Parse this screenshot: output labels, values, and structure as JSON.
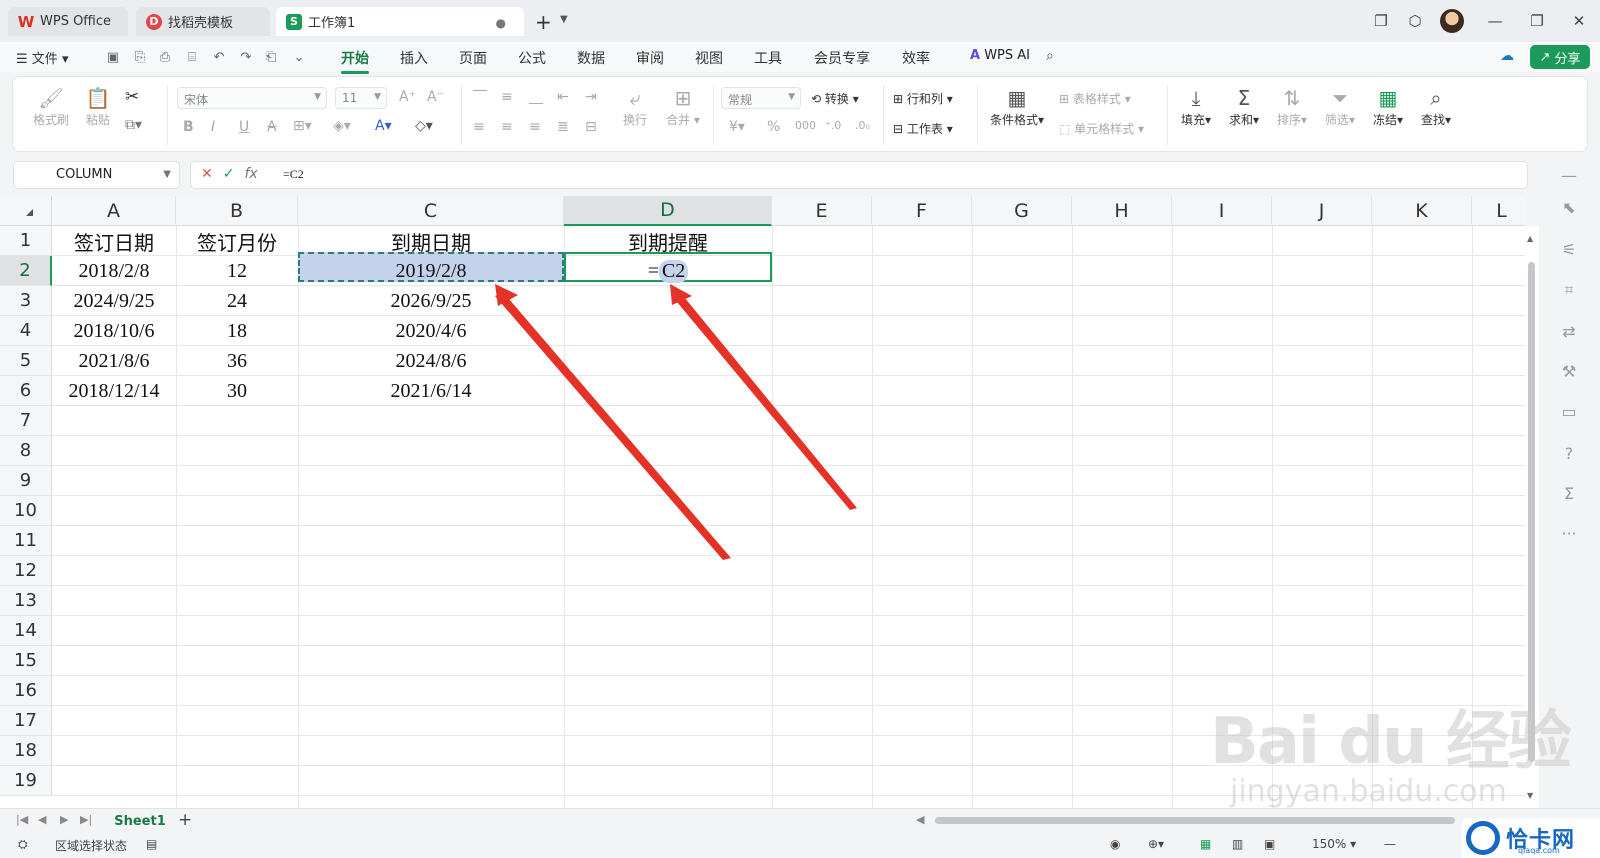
{
  "tabs": [
    {
      "label": "WPS Office"
    },
    {
      "label": "找稻壳模板"
    },
    {
      "label": "工作簿1"
    }
  ],
  "menu": {
    "file": "文件",
    "tabs": [
      "开始",
      "插入",
      "页面",
      "公式",
      "数据",
      "审阅",
      "视图",
      "工具",
      "会员专享",
      "效率"
    ],
    "active_tab": "开始",
    "wps_ai": "WPS AI",
    "share": "分享"
  },
  "ribbon": {
    "format_painter": "格式刷",
    "paste": "粘贴",
    "font_name": "宋体",
    "font_size": "11",
    "wrap": "换行",
    "merge": "合并",
    "number_format": "常规",
    "convert": "转换",
    "rows_cols": "行和列",
    "worksheet": "工作表",
    "cond_format": "条件格式",
    "table_style": "表格样式",
    "cell_style": "单元格样式",
    "fill": "填充",
    "sum": "求和",
    "sort": "排序",
    "filter": "筛选",
    "freeze": "冻结",
    "find": "查找"
  },
  "formula_bar": {
    "name_box": "COLUMN",
    "formula": "=C2"
  },
  "sheet": {
    "columns": [
      "A",
      "B",
      "C",
      "D",
      "E",
      "F",
      "G",
      "H",
      "I",
      "J",
      "K",
      "L"
    ],
    "selected_column": "D",
    "selected_row": "2",
    "rows": [
      "1",
      "2",
      "3",
      "4",
      "5",
      "6",
      "7",
      "8",
      "9",
      "10",
      "11",
      "12",
      "13",
      "14",
      "15",
      "16",
      "17",
      "18",
      "19"
    ],
    "header_row": {
      "A": "签订日期",
      "B": "签订月份",
      "C": "到期日期",
      "D": "到期提醒"
    },
    "data": [
      {
        "A": "2018/2/8",
        "B": "12",
        "C": "2019/2/8"
      },
      {
        "A": "2024/9/25",
        "B": "24",
        "C": "2026/9/25"
      },
      {
        "A": "2018/10/6",
        "B": "18",
        "C": "2020/4/6"
      },
      {
        "A": "2021/8/6",
        "B": "36",
        "C": "2024/8/6"
      },
      {
        "A": "2018/12/14",
        "B": "30",
        "C": "2021/6/14"
      }
    ],
    "editing_cell": {
      "eq": "=",
      "ref": "C2"
    }
  },
  "sheet_tabs": [
    "Sheet1"
  ],
  "status": {
    "mode": "区域选择状态",
    "zoom": "150%"
  },
  "watermark": {
    "brand": "Bai du 经验",
    "url": "jingyan.baidu.com",
    "logo": "恰卡网",
    "logo_url": "qiaqa.com"
  },
  "accent_color": "#1a9b5a",
  "arrow_color": "#e53227"
}
